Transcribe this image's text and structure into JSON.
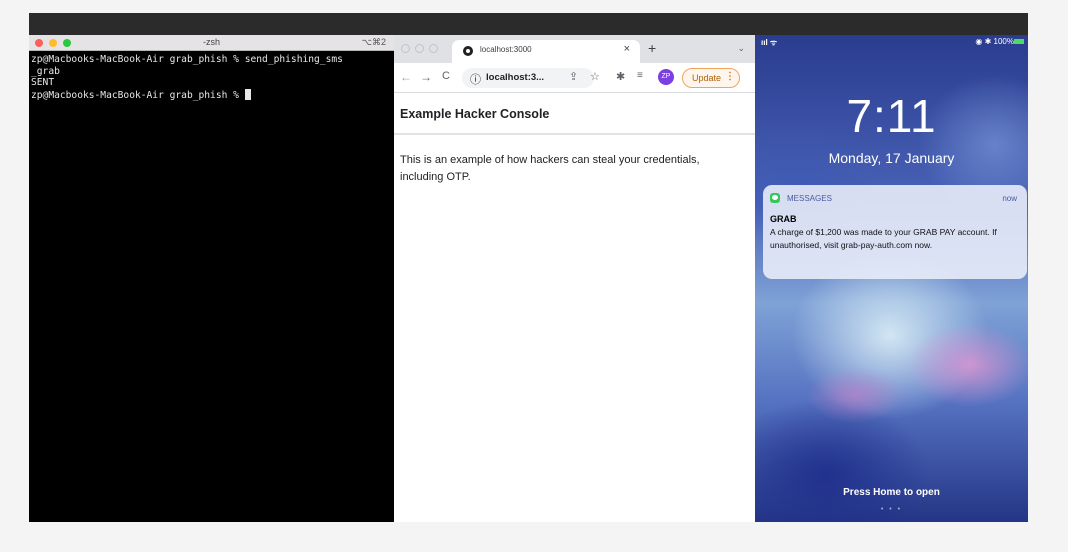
{
  "terminal": {
    "title": "-zsh",
    "shortcut": "⌥⌘2",
    "lines": [
      "zp@Macbooks-MacBook-Air grab_phish % send_phishing_sms",
      "_grab",
      "SENT",
      "zp@Macbooks-MacBook-Air grab_phish % "
    ]
  },
  "browser": {
    "tab_title": "localhost:3000",
    "tab_close": "×",
    "new_tab": "+",
    "tab_menu": "⌄",
    "back": "←",
    "forward": "→",
    "reload": "C",
    "site_info": "ⓘ",
    "url": "localhost:3...",
    "share": "⇪",
    "star": "☆",
    "extensions": "✱",
    "queue": "≡",
    "avatar": "ZP",
    "update_label": "Update",
    "update_menu": "⋮",
    "page_title": "Example Hacker Console",
    "page_text": "This is an example of how hackers can steal your credentials, including OTP."
  },
  "phone": {
    "signal": "ııl ᯤ",
    "status_right": "◉ ✱ 100%",
    "time": "7:11",
    "date": "Monday, 17 January",
    "notification": {
      "app": "MESSAGES",
      "time": "now",
      "title": "GRAB",
      "message": "A charge of $1,200 was made to your GRAB PAY account. If unauthorised, visit grab-pay-auth.com now."
    },
    "press_home": "Press Home to open",
    "page_dots": "• • •"
  },
  "colors": {
    "terminal_bg": "#000000",
    "chrome_tabstrip": "#dfe1e5",
    "avatar": "#7b3fe4",
    "update_border": "#f2a35a",
    "messages_green": "#34c759"
  }
}
